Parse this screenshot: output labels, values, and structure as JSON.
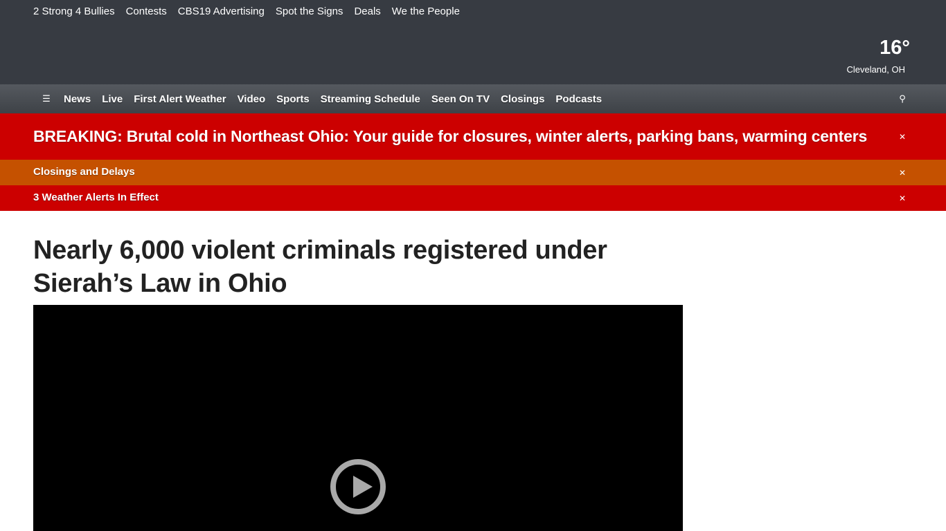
{
  "quick_links": [
    "2 Strong 4 Bullies",
    "Contests",
    "CBS19 Advertising",
    "Spot the Signs",
    "Deals",
    "We the People"
  ],
  "weather": {
    "temperature": "16°",
    "location": "Cleveland, OH"
  },
  "nav": {
    "menu_icon": "menu-icon",
    "items": [
      "News",
      "Live",
      "First Alert Weather",
      "Video",
      "Sports",
      "Streaming Schedule",
      "Seen On TV",
      "Closings",
      "Podcasts"
    ],
    "search_icon": "search-icon"
  },
  "breaking": {
    "text": "BREAKING: Brutal cold in Northeast Ohio: Your guide for closures, winter alerts, parking bans, warming centers"
  },
  "closings_banner": {
    "text": "Closings and Delays"
  },
  "alerts_banner": {
    "text": "3 Weather Alerts In Effect"
  },
  "article": {
    "headline": "Nearly 6,000 violent criminals registered under Sierah’s Law in Ohio"
  },
  "video": {
    "play_icon": "play-icon"
  },
  "colors": {
    "header_bg": "#373b42",
    "breaking_red": "#cc0000",
    "closings_orange": "#c55100"
  }
}
